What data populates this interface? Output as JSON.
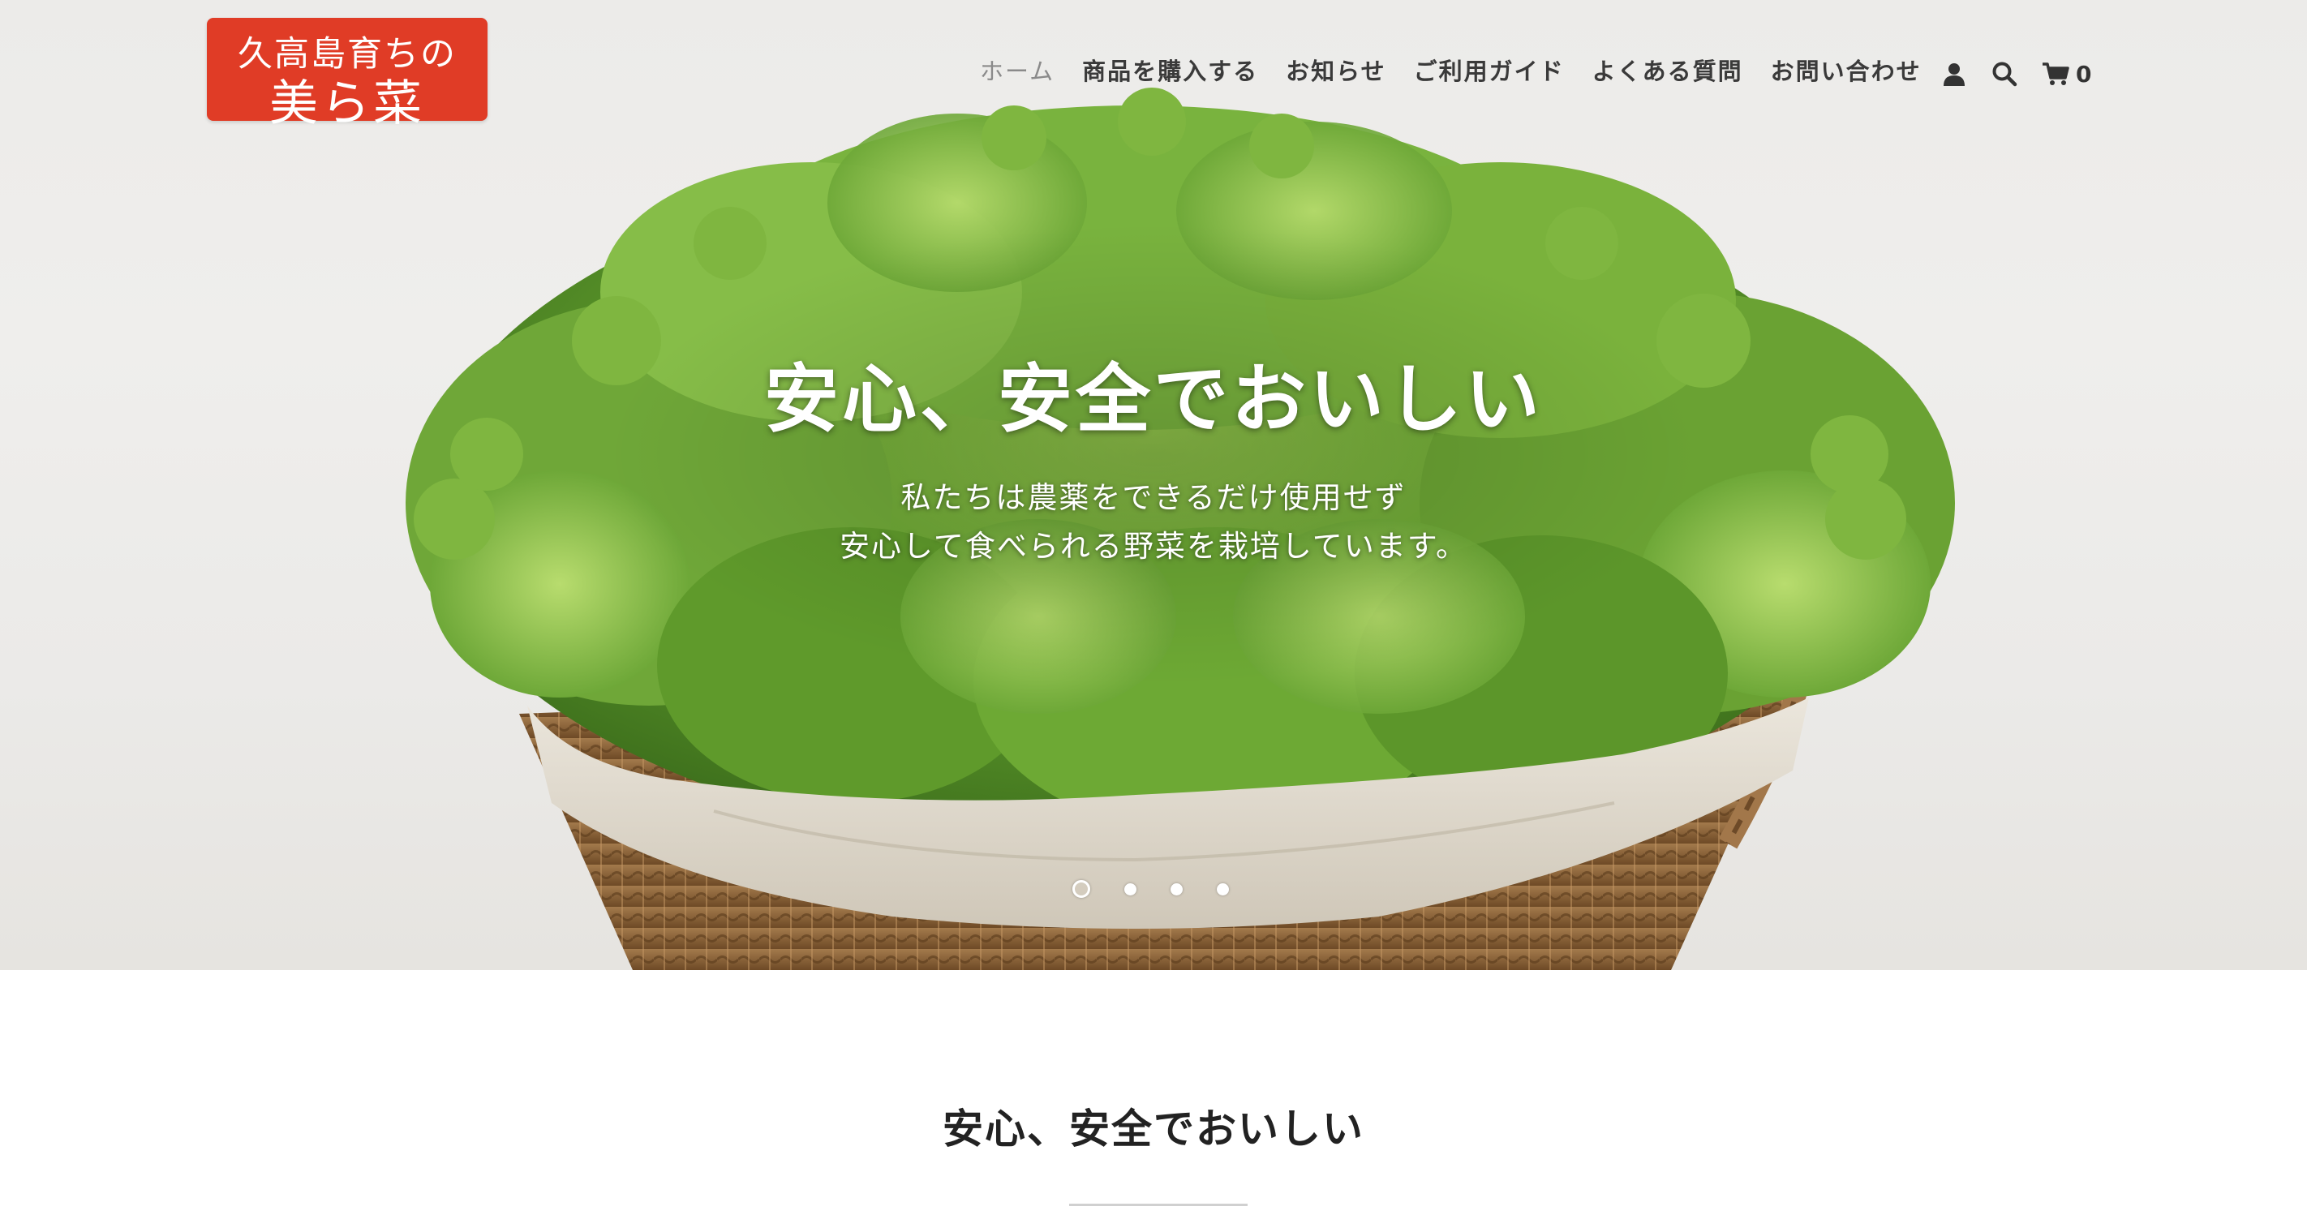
{
  "header": {
    "logo_line1": "久高島育ちの",
    "logo_line2": "美ら菜",
    "logo_color": "#e03c26",
    "nav": [
      {
        "label": "ホーム",
        "active": true
      },
      {
        "label": "商品を購入する",
        "active": false
      },
      {
        "label": "お知らせ",
        "active": false
      },
      {
        "label": "ご利用ガイド",
        "active": false
      },
      {
        "label": "よくある質問",
        "active": false
      },
      {
        "label": "お問い合わせ",
        "active": false
      }
    ],
    "icons": [
      "account-icon",
      "search-icon",
      "cart-icon"
    ],
    "cart_count": "0"
  },
  "hero": {
    "heading": "安心、安全でおいしい",
    "subtext_line1": "私たちは農薬をできるだけ使用せず",
    "subtext_line2": "安心して食べられる野菜を栽培しています。",
    "image_subject": "leafy-lettuce-in-wicker-basket",
    "slides_total": 4,
    "slide_active": 1
  },
  "section": {
    "title": "安心、安全でおいしい"
  }
}
